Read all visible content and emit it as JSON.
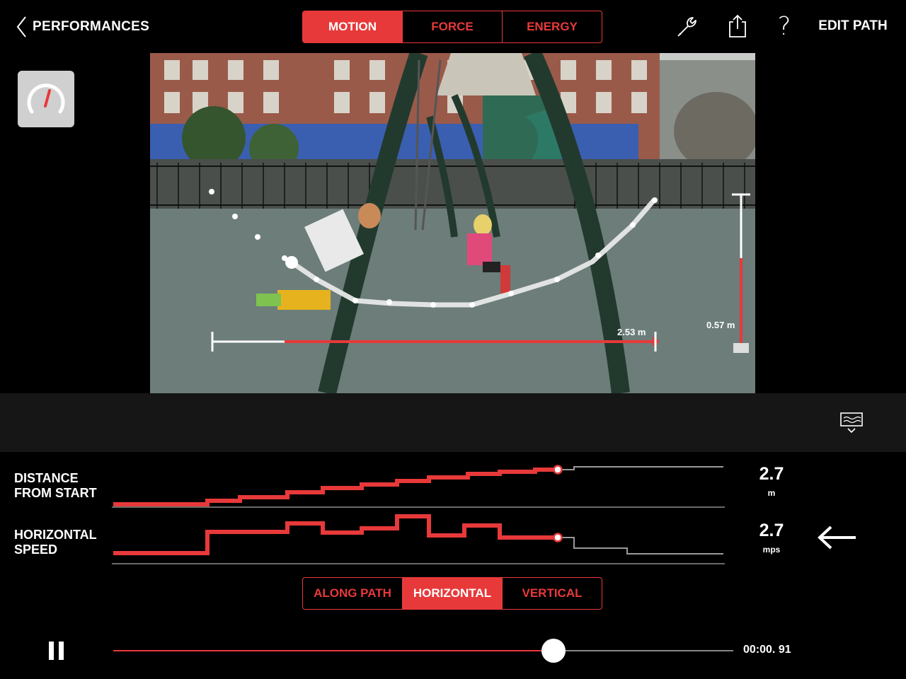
{
  "nav": {
    "back_label": "PERFORMANCES",
    "edit_label": "EDIT PATH"
  },
  "modes": {
    "motion": "MOTION",
    "force": "FORCE",
    "energy": "ENERGY",
    "selected": "MOTION"
  },
  "toolbar": {
    "icons": [
      "wrench-icon",
      "share-icon",
      "help-icon"
    ],
    "help_glyph": "?"
  },
  "side": {
    "icon": "speedometer-icon"
  },
  "video": {
    "horizontal_measure": "2.53 m",
    "vertical_measure": "0.57 m"
  },
  "graphs": {
    "distance": {
      "label_line1": "DISTANCE",
      "label_line2": "FROM START",
      "value": "2.7",
      "unit": "m"
    },
    "speed": {
      "label_line1": "HORIZONTAL",
      "label_line2": "SPEED",
      "value": "2.7",
      "unit": "mps",
      "direction_icon": "arrow-left-icon"
    }
  },
  "components": {
    "along_path": "ALONG PATH",
    "horizontal": "HORIZONTAL",
    "vertical": "VERTICAL",
    "selected": "HORIZONTAL"
  },
  "playback": {
    "time": "00:00. 91",
    "progress": 0.71,
    "state_icon": "pause-icon"
  },
  "colors": {
    "accent": "#e8393a",
    "background": "#000000",
    "band": "#161616"
  }
}
